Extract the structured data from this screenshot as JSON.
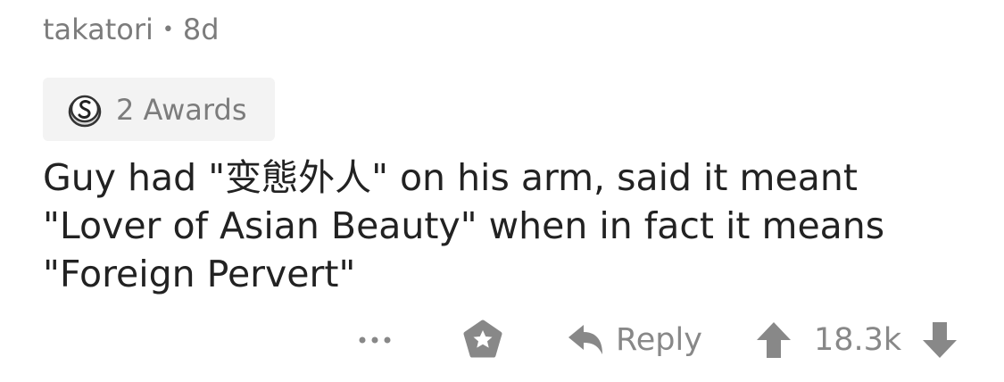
{
  "comment": {
    "author": "takatori",
    "separator": "•",
    "age": "8d",
    "awards_label": "2 Awards",
    "award_icon": "silver-award-icon",
    "body_lines": [
      "Guy had \"变態外人\" on his arm, said it meant",
      "\"Lover of Asian Beauty\" when in fact it means",
      "\"Foreign Pervert\""
    ]
  },
  "actions": {
    "more_label": "•••",
    "award_icon": "award-icon",
    "reply_icon": "reply-arrow-icon",
    "reply_label": "Reply",
    "upvote_icon": "upvote-arrow-icon",
    "score": "18.3k",
    "downvote_icon": "downvote-arrow-icon"
  },
  "colors": {
    "meta_text": "#7c7c7c",
    "body_text": "#222222",
    "icon_gray": "#888888",
    "award_chip_bg": "#f3f3f3"
  }
}
